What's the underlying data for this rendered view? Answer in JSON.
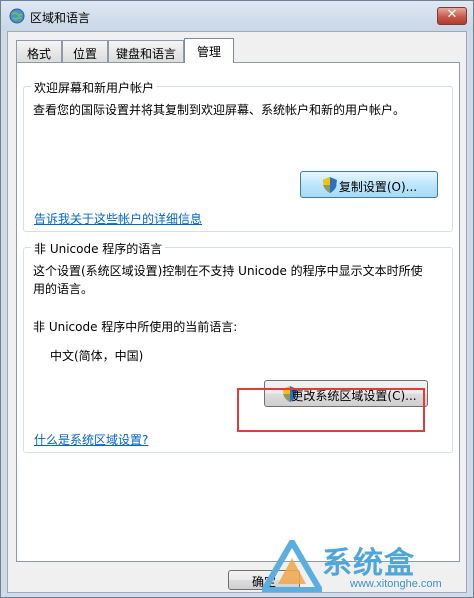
{
  "window": {
    "title": "区域和语言"
  },
  "tabs": [
    {
      "label": "格式"
    },
    {
      "label": "位置"
    },
    {
      "label": "键盘和语言"
    },
    {
      "label": "管理"
    }
  ],
  "welcome_group": {
    "label": "欢迎屏幕和新用户帐户",
    "description": "查看您的国际设置并将其复制到欢迎屏幕、系统帐户和新的用户帐户。",
    "copy_button": "复制设置(O)...",
    "link": "告诉我关于这些帐户的详细信息"
  },
  "unicode_group": {
    "label": "非 Unicode 程序的语言",
    "description_line1": "这个设置(系统区域设置)控制在不支持 Unicode 的程序中显示文本时所使",
    "description_line2": "用的语言。",
    "current_label": "非 Unicode 程序中所使用的当前语言:",
    "current_value": "中文(简体，中国)",
    "change_button": "更改系统区域设置(C)...",
    "link": "什么是系统区域设置?"
  },
  "footer": {
    "ok_button": "确定"
  },
  "watermark": {
    "title": "系统盒",
    "url": "www.xitonghe.com"
  },
  "colors": {
    "link": "#0066cc",
    "highlight": "#e23b3b",
    "shield_blue": "#2f6fc4",
    "shield_yellow": "#f5c400"
  }
}
